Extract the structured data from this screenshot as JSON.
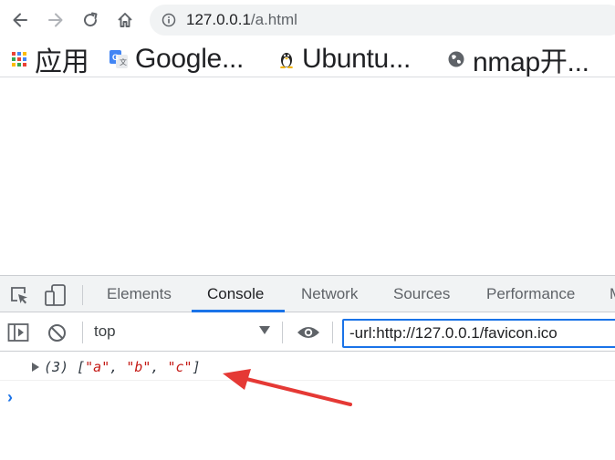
{
  "browser": {
    "url_host": "127.0.0.1",
    "url_path": "/a.html"
  },
  "bookmarks": [
    {
      "label": "应用",
      "icon": "apps-grid-icon"
    },
    {
      "label": "Google...",
      "icon": "google-translate-icon"
    },
    {
      "label": "Ubuntu...",
      "icon": "tux-penguin-icon"
    },
    {
      "label": "nmap开...",
      "icon": "globe-icon"
    }
  ],
  "devtools": {
    "tabs": [
      "Elements",
      "Console",
      "Network",
      "Sources",
      "Performance",
      "M"
    ],
    "active_tab": "Console",
    "context": "top",
    "filter_value": "-url:http://127.0.0.1/favicon.ico",
    "log": {
      "count": "(3)",
      "open": "[",
      "items": [
        "\"a\"",
        "\"b\"",
        "\"c\""
      ],
      "sep": ", ",
      "close": "]"
    },
    "prompt": "›"
  },
  "colors": {
    "accent": "#1a73e8",
    "string": "#c41a16",
    "arrow": "#e53935"
  }
}
